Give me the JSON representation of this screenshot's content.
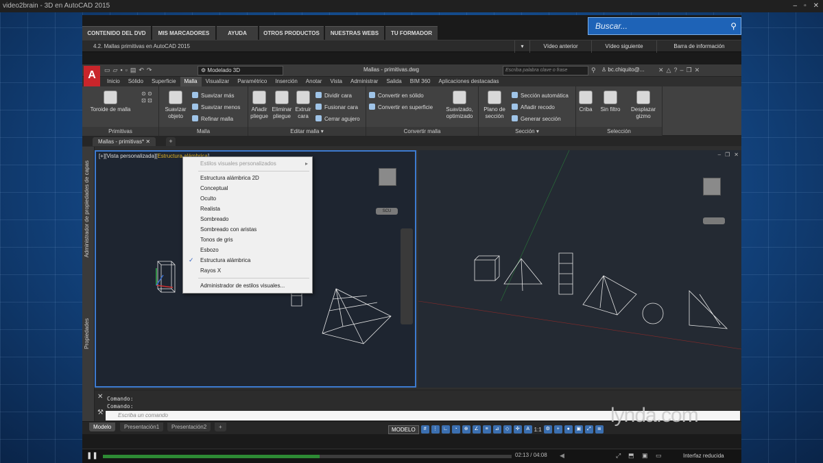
{
  "window": {
    "title": "video2brain - 3D en AutoCAD 2015",
    "controls": [
      "–",
      "▫",
      "✕"
    ]
  },
  "site_nav": [
    "CONTENIDO DEL DVD",
    "MIS MARCADORES",
    "AYUDA",
    "OTROS PRODUCTOS",
    "NUESTRAS WEBS",
    "TU FORMADOR"
  ],
  "search": {
    "placeholder": "Buscar..."
  },
  "lesson": {
    "title": "4.2.  Mallas primitivas en AutoCAD 2015",
    "prev": "Vídeo anterior",
    "next": "Vídeo siguiente",
    "info": "Barra de información"
  },
  "acad": {
    "workspace": "Modelado 3D",
    "file_title": "Mallas - primitivas.dwg",
    "keyword_placeholder": "Escriba palabra clave o frase",
    "user": "bc.chiquito@...",
    "ribbon_tabs": [
      "Inicio",
      "Sólido",
      "Superficie",
      "Malla",
      "Visualizar",
      "Paramétrico",
      "Inserción",
      "Anotar",
      "Vista",
      "Administrar",
      "Salida",
      "BIM 360",
      "Aplicaciones destacadas"
    ],
    "active_tab": "Malla",
    "panels": {
      "primitivas": {
        "title": "Primitivas",
        "toroide": "Toroide de malla"
      },
      "malla": {
        "title": "Malla",
        "suavizar": "Suavizar objeto",
        "mas": "Suavizar más",
        "menos": "Suavizar menos",
        "refinar": "Refinar malla"
      },
      "editar": {
        "title": "Editar malla",
        "anadir": "Añadir pliegue",
        "eliminar": "Eliminar pliegue",
        "extruir": "Extruir cara",
        "dividir": "Dividir cara",
        "fusionar": "Fusionar cara",
        "cerrar": "Cerrar agujero"
      },
      "convertir": {
        "title": "Convertir malla",
        "solido": "Convertir en sólido",
        "superficie": "Convertir en superficie",
        "suavizado": "Suavizado, optimizado"
      },
      "seccion": {
        "title": "Sección",
        "plano": "Plano de sección",
        "auto": "Sección automática",
        "recodo": "Añadir recodo",
        "generar": "Generar sección"
      },
      "seleccion": {
        "title": "Selección",
        "criba": "Criba",
        "filtro": "Sin filtro",
        "gizmo": "Desplazar gizmo"
      }
    },
    "doc_tab": "Mallas - primitivas*",
    "side_palettes": [
      "Administrador de propiedades de capas",
      "Propiedades"
    ],
    "viewport_label": {
      "prefix": "[+][Vista personalizada][",
      "style": "Estructura alámbrica",
      "suffix": "]"
    },
    "viewport_controls": [
      "–",
      "❐",
      "✕"
    ],
    "viewcube": {
      "face": "DERECHA",
      "scu": "SCU"
    },
    "context_menu": {
      "header": "Estilos visuales personalizados",
      "items": [
        "Estructura alámbrica 2D",
        "Conceptual",
        "Oculto",
        "Realista",
        "Sombreado",
        "Sombreado con aristas",
        "Tonos de gris",
        "Esbozo",
        "Estructura alámbrica",
        "Rayos X"
      ],
      "checked": "Estructura alámbrica",
      "footer": "Administrador de estilos visuales..."
    },
    "command": {
      "history": [
        "Comando:",
        "Comando:"
      ],
      "placeholder": "Escriba un comando"
    },
    "layout_tabs": [
      "Modelo",
      "Presentación1",
      "Presentación2"
    ],
    "status": {
      "model": "MODELO",
      "scale": "1:1"
    }
  },
  "watermark": "lynda.com",
  "player": {
    "time": "02:13 / 04:08",
    "progress": 0.53,
    "mode": "Interfaz reducida"
  },
  "colors": {
    "accent": "#3d7bd1",
    "autocad_red": "#c9252b",
    "highlight": "#e0b428",
    "progress": "#2d8a34"
  }
}
